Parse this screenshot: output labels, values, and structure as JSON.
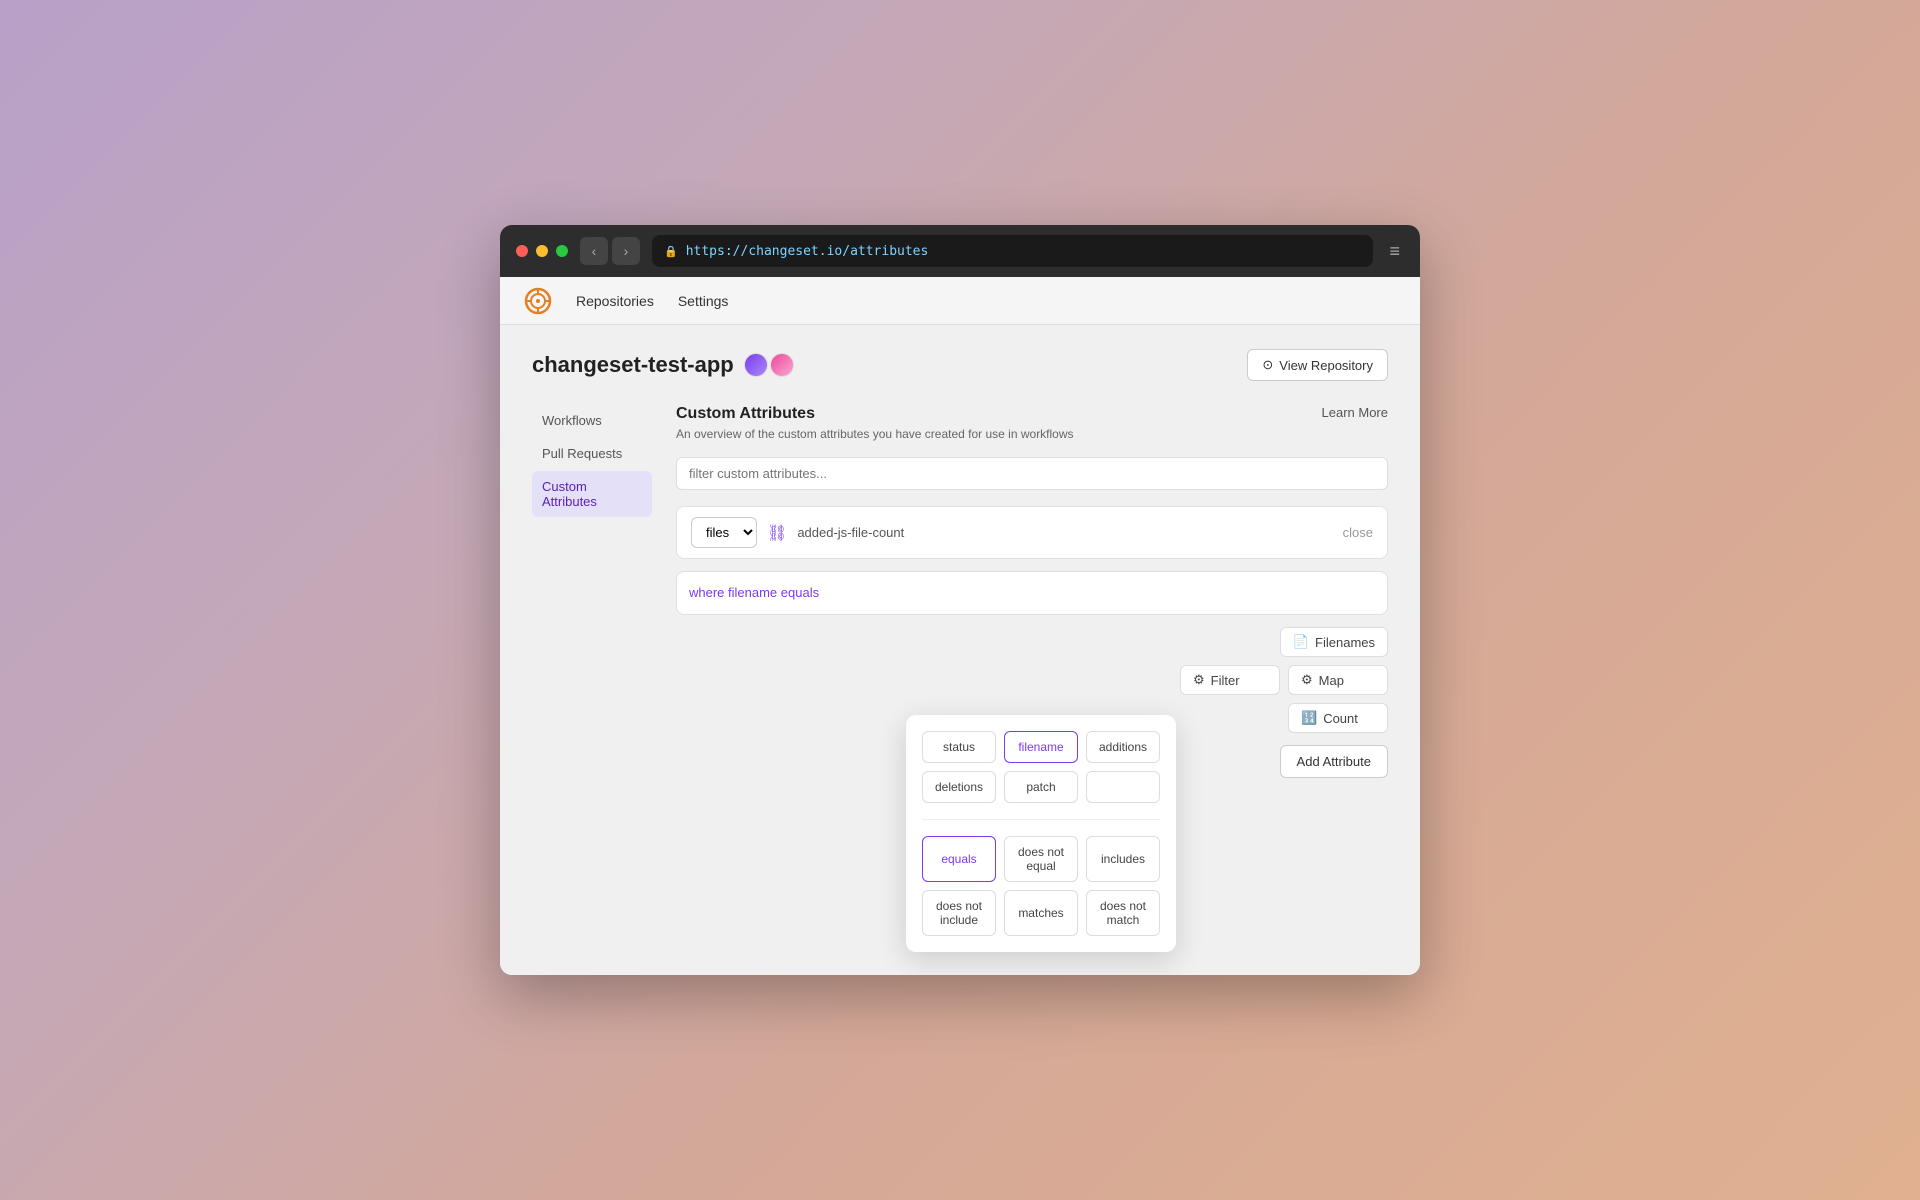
{
  "browser": {
    "url": "https://changeset.io/attributes",
    "back_label": "‹",
    "forward_label": "›",
    "menu_label": "≡"
  },
  "topnav": {
    "repositories_label": "Repositories",
    "settings_label": "Settings"
  },
  "repo": {
    "name": "changeset-test-app",
    "view_repository_label": "View Repository"
  },
  "sidebar": {
    "items": [
      {
        "label": "Workflows",
        "id": "workflows"
      },
      {
        "label": "Pull Requests",
        "id": "pull-requests"
      },
      {
        "label": "Custom Attributes",
        "id": "custom-attributes",
        "active": true
      }
    ]
  },
  "section": {
    "title": "Custom Attributes",
    "description": "An overview of the custom attributes you have created for use in workflows",
    "learn_more_label": "Learn More",
    "filter_placeholder": "filter custom attributes..."
  },
  "attribute": {
    "type_value": "files",
    "name": "added-js-file-count",
    "close_label": "close",
    "condition_text": "where filename equals"
  },
  "action_buttons": [
    {
      "label": "Filenames",
      "icon": "📄"
    },
    {
      "label": "Filter",
      "icon": "⚙"
    },
    {
      "label": "Map",
      "icon": "⚙"
    },
    {
      "label": "Count",
      "icon": "🔢"
    }
  ],
  "add_attribute_label": "Add Attribute",
  "popup": {
    "field_options": [
      {
        "label": "status",
        "selected": false
      },
      {
        "label": "filename",
        "selected": true
      },
      {
        "label": "additions",
        "selected": false
      },
      {
        "label": "deletions",
        "selected": false
      },
      {
        "label": "patch",
        "selected": false
      },
      {
        "label": "",
        "selected": false
      }
    ],
    "operator_options": [
      {
        "label": "equals",
        "selected": true
      },
      {
        "label": "does not equal",
        "selected": false
      },
      {
        "label": "includes",
        "selected": false
      },
      {
        "label": "does not include",
        "selected": false
      },
      {
        "label": "matches",
        "selected": false
      },
      {
        "label": "does not match",
        "selected": false
      }
    ]
  }
}
